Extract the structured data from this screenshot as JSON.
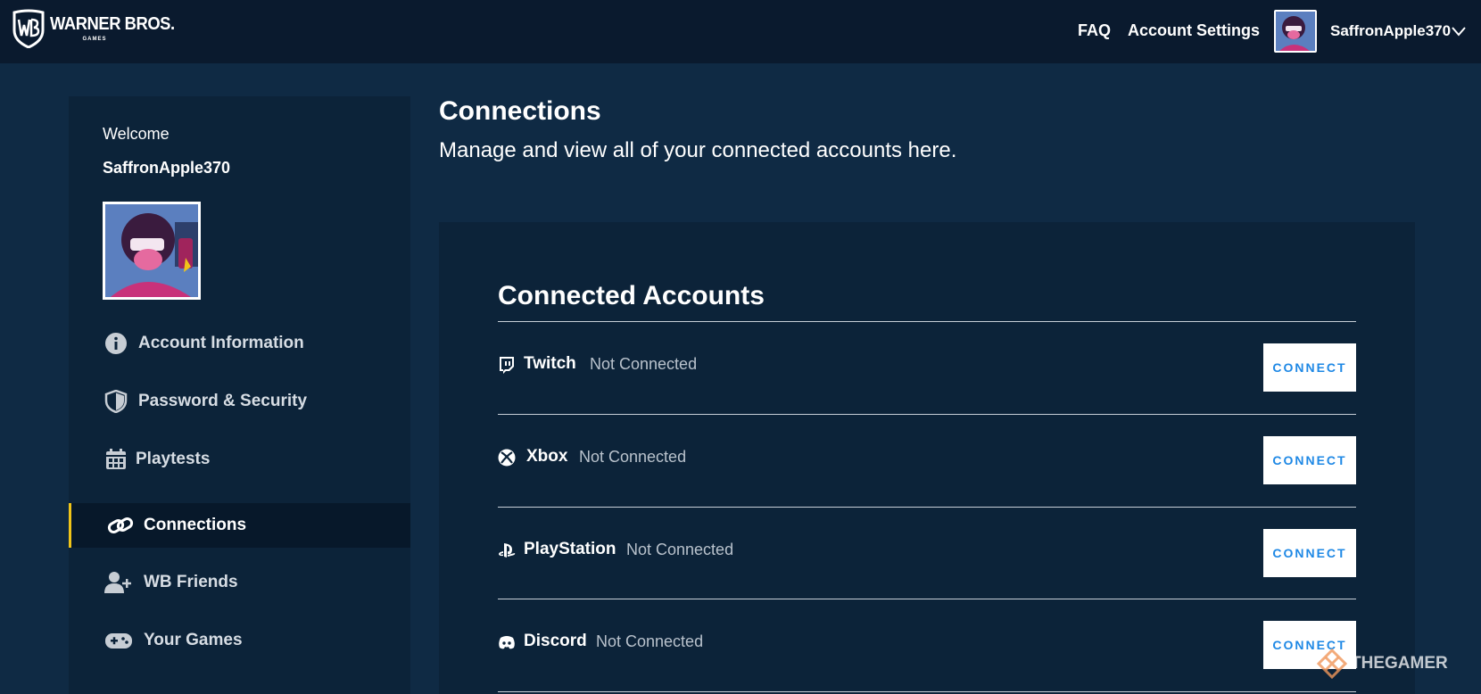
{
  "header": {
    "logo_main": "WARNER BROS.",
    "logo_sub": "GAMES",
    "faq_label": "FAQ",
    "account_settings_label": "Account Settings",
    "username": "SaffronApple370"
  },
  "sidebar": {
    "welcome": "Welcome",
    "username": "SaffronApple370",
    "items": [
      {
        "label": "Account Information",
        "icon": "info-icon"
      },
      {
        "label": "Password & Security",
        "icon": "shield-icon"
      },
      {
        "label": "Playtests",
        "icon": "calendar-icon"
      },
      {
        "label": "Connections",
        "icon": "link-icon",
        "active": true
      },
      {
        "label": "WB Friends",
        "icon": "add-user-icon"
      },
      {
        "label": "Your Games",
        "icon": "gamepad-icon"
      }
    ]
  },
  "main": {
    "title": "Connections",
    "subtitle": "Manage and view all of your connected accounts here.",
    "panel_title": "Connected Accounts",
    "accounts": [
      {
        "name": "Twitch",
        "status": "Not Connected",
        "button": "CONNECT",
        "icon": "twitch-icon"
      },
      {
        "name": "Xbox",
        "status": "Not Connected",
        "button": "CONNECT",
        "icon": "xbox-icon"
      },
      {
        "name": "PlayStation",
        "status": "Not Connected",
        "button": "CONNECT",
        "icon": "playstation-icon"
      },
      {
        "name": "Discord",
        "status": "Not Connected",
        "button": "CONNECT",
        "icon": "discord-icon"
      }
    ]
  },
  "watermark": "THEGAMER",
  "colors": {
    "background": "#0f2a44",
    "topbar": "#0a1a2e",
    "panel": "#0c2339",
    "active_accent": "#f0c419",
    "button_text": "#1e88e5"
  }
}
